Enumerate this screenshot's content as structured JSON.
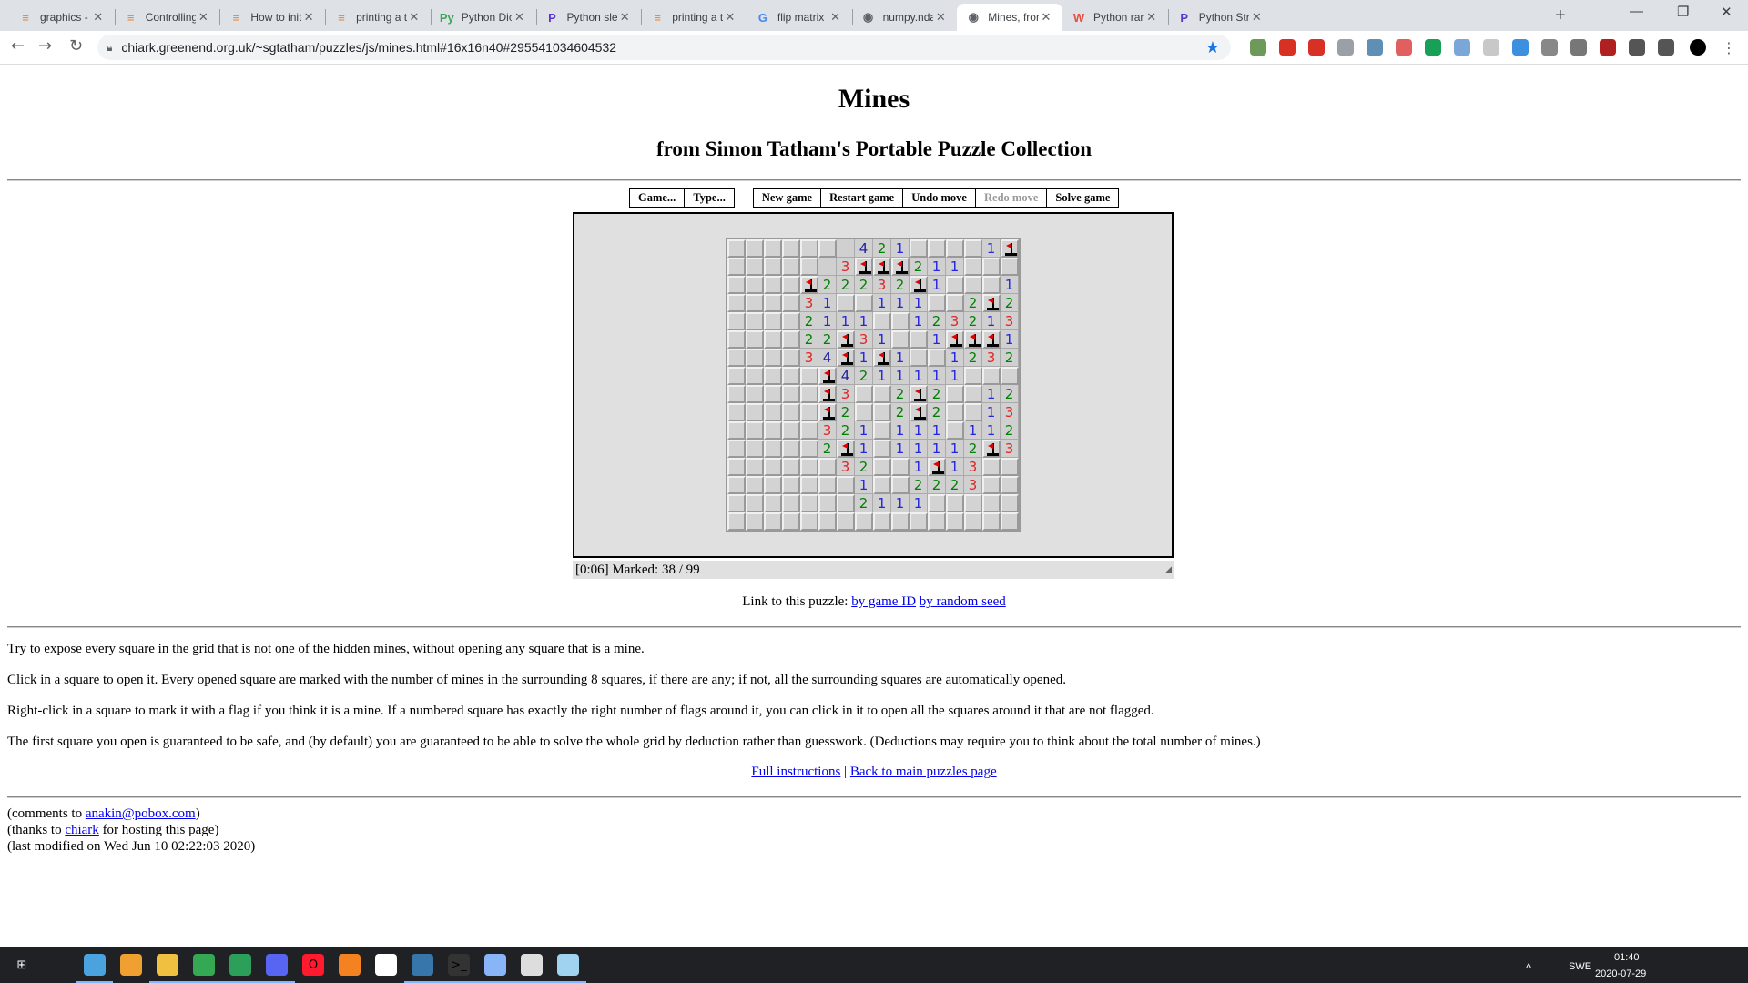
{
  "tabs": [
    {
      "label": "graphics - How",
      "icon": "stackoverflow-icon"
    },
    {
      "label": "Controlling m",
      "icon": "stackoverflow-icon"
    },
    {
      "label": "How to initializ",
      "icon": "stackoverflow-icon"
    },
    {
      "label": "printing a two",
      "icon": "stackoverflow-icon"
    },
    {
      "label": "Python Diction",
      "icon": "python-icon"
    },
    {
      "label": "Python sleep()",
      "icon": "programiz-icon"
    },
    {
      "label": "printing a two",
      "icon": "stackoverflow-icon"
    },
    {
      "label": "flip matrix num",
      "icon": "google-icon"
    },
    {
      "label": "numpy.ndarra",
      "icon": "globe-icon"
    },
    {
      "label": "Mines, from Si",
      "icon": "globe-icon",
      "active": true
    },
    {
      "label": "Python range()",
      "icon": "w3-icon"
    },
    {
      "label": "Python String",
      "icon": "programiz-icon"
    }
  ],
  "address": {
    "url": "chiark.greenend.org.uk/~sgtatham/puzzles/js/mines.html#16x16n40#295541034604532"
  },
  "page": {
    "title": "Mines",
    "subtitle": "from Simon Tatham's Portable Puzzle Collection",
    "buttons": {
      "game": "Game...",
      "type": "Type...",
      "new_game": "New game",
      "restart": "Restart game",
      "undo": "Undo move",
      "redo": "Redo move",
      "solve": "Solve game"
    },
    "status": "[0:06] Marked: 38 / 99",
    "link_label": "Link to this puzzle:",
    "link_game_id": "by game ID",
    "link_seed": "by random seed",
    "p1": "Try to expose every square in the grid that is not one of the hidden mines, without opening any square that is a mine.",
    "p2": "Click in a square to open it. Every opened square are marked with the number of mines in the surrounding 8 squares, if there are any; if not, all the surrounding squares are automatically opened.",
    "p3": "Right-click in a square to mark it with a flag if you think it is a mine. If a numbered square has exactly the right number of flags around it, you can click in it to open all the squares around it that are not flagged.",
    "p4": "The first square you open is guaranteed to be safe, and (by default) you are guaranteed to be able to solve the whole grid by deduction rather than guesswork. (Deductions may require you to think about the total number of mines.)",
    "full_instructions": "Full instructions",
    "separator": "|",
    "back_link": "Back to main puzzles page",
    "comments_pre": "(comments to",
    "comments_email": "anakin@pobox.com",
    "comments_post": ")",
    "thanks_pre": "(thanks to",
    "thanks_link": "chiark",
    "thanks_post": "for hosting this page)",
    "modified": "(last modified on Wed Jun 10 02:22:03 2020)"
  },
  "board": {
    "legend": "# = covered, F = flag, . = open empty, digit = open number",
    "rows": [
      "######.421####1F12########",
      "#####.3FFF211###111F3F#####",
      "####F22232F1###111##3F#####",
      "####31##111##2F2##2F######",
      "####2111##1232131F3##13####",
      "####22F31##1FFF1213F1##2####",
      "####34F1F1##1232113F2#13####",
      "#####F4211111####2F2##1F####",
      "#####F3##2F2##1221##12####",
      "#####F2##2F2##131F31###2####",
      "#####321#111#1122FFF31##2####",
      "#####2F1#11112F33##F112####",
      "######32##1F13###5312F####",
      "#######1##2223##FF1##2F####",
      "#######2111#######321##12####",
      "################1####1####"
    ]
  },
  "colors": {
    "num1": "#2525e0",
    "num2": "#008000",
    "num3": "#e02525",
    "num4": "#1f1fa0",
    "num5": "#a01f1f",
    "flag": "#e00000",
    "link": "#0000ee"
  },
  "tray": {
    "lang": "SWE",
    "time": "01:40",
    "date": "2020-07-29"
  }
}
